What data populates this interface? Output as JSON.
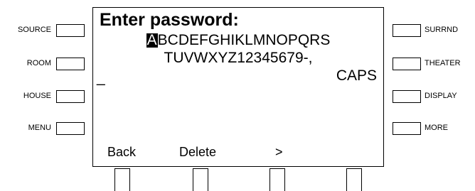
{
  "left_buttons": [
    {
      "label": "SOURCE"
    },
    {
      "label": "ROOM"
    },
    {
      "label": "HOUSE"
    },
    {
      "label": "MENU"
    }
  ],
  "right_buttons": [
    {
      "label": "SURRND"
    },
    {
      "label": "THEATER"
    },
    {
      "label": "DISPLAY"
    },
    {
      "label": "MORE"
    }
  ],
  "screen": {
    "title": "Enter password:",
    "selected_char": "A",
    "charset_line1_rest": "BCDEFGHIKLMNOPQRS",
    "charset_line2": "TUVWXYZ12345679-,",
    "cursor": "_",
    "caps_label": "CAPS",
    "softkeys": [
      "Back",
      "Delete",
      ">"
    ]
  }
}
